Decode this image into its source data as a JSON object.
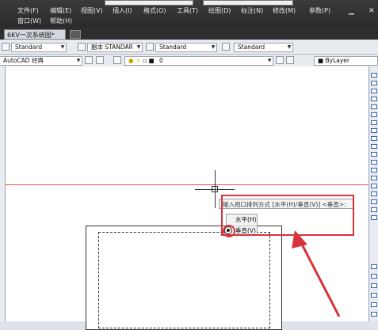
{
  "menubar": {
    "row1": [
      "文件(F)",
      "编辑(E)",
      "视图(V)",
      "插入(I)",
      "格式(O)",
      "工具(T)",
      "绘图(D)",
      "标注(N)",
      "修改(M)",
      "参数(P)"
    ],
    "row2": [
      "窗口(W)",
      "帮助(H)"
    ]
  },
  "tabs": {
    "active": "6KV一次系统图*"
  },
  "toolbar1": {
    "text_style": "Standard",
    "dim_style": "副本 STANDAR",
    "table_style": "Standard",
    "multileader_style": "Standard"
  },
  "toolbar2": {
    "workspace": "AutoCAD 经典",
    "layer": "0",
    "color": "ByLayer"
  },
  "command": {
    "prompt": "输入视口排列方式 [水平(H)/垂直(V)] <垂直>:",
    "options": [
      "水平(H)",
      "垂直(V)"
    ],
    "selected_option": "垂直(V)"
  },
  "colors": {
    "annotation_red": "#d8323a",
    "menubar_bg": "#2b2b2b",
    "canvas_bg": "#ffffff"
  }
}
